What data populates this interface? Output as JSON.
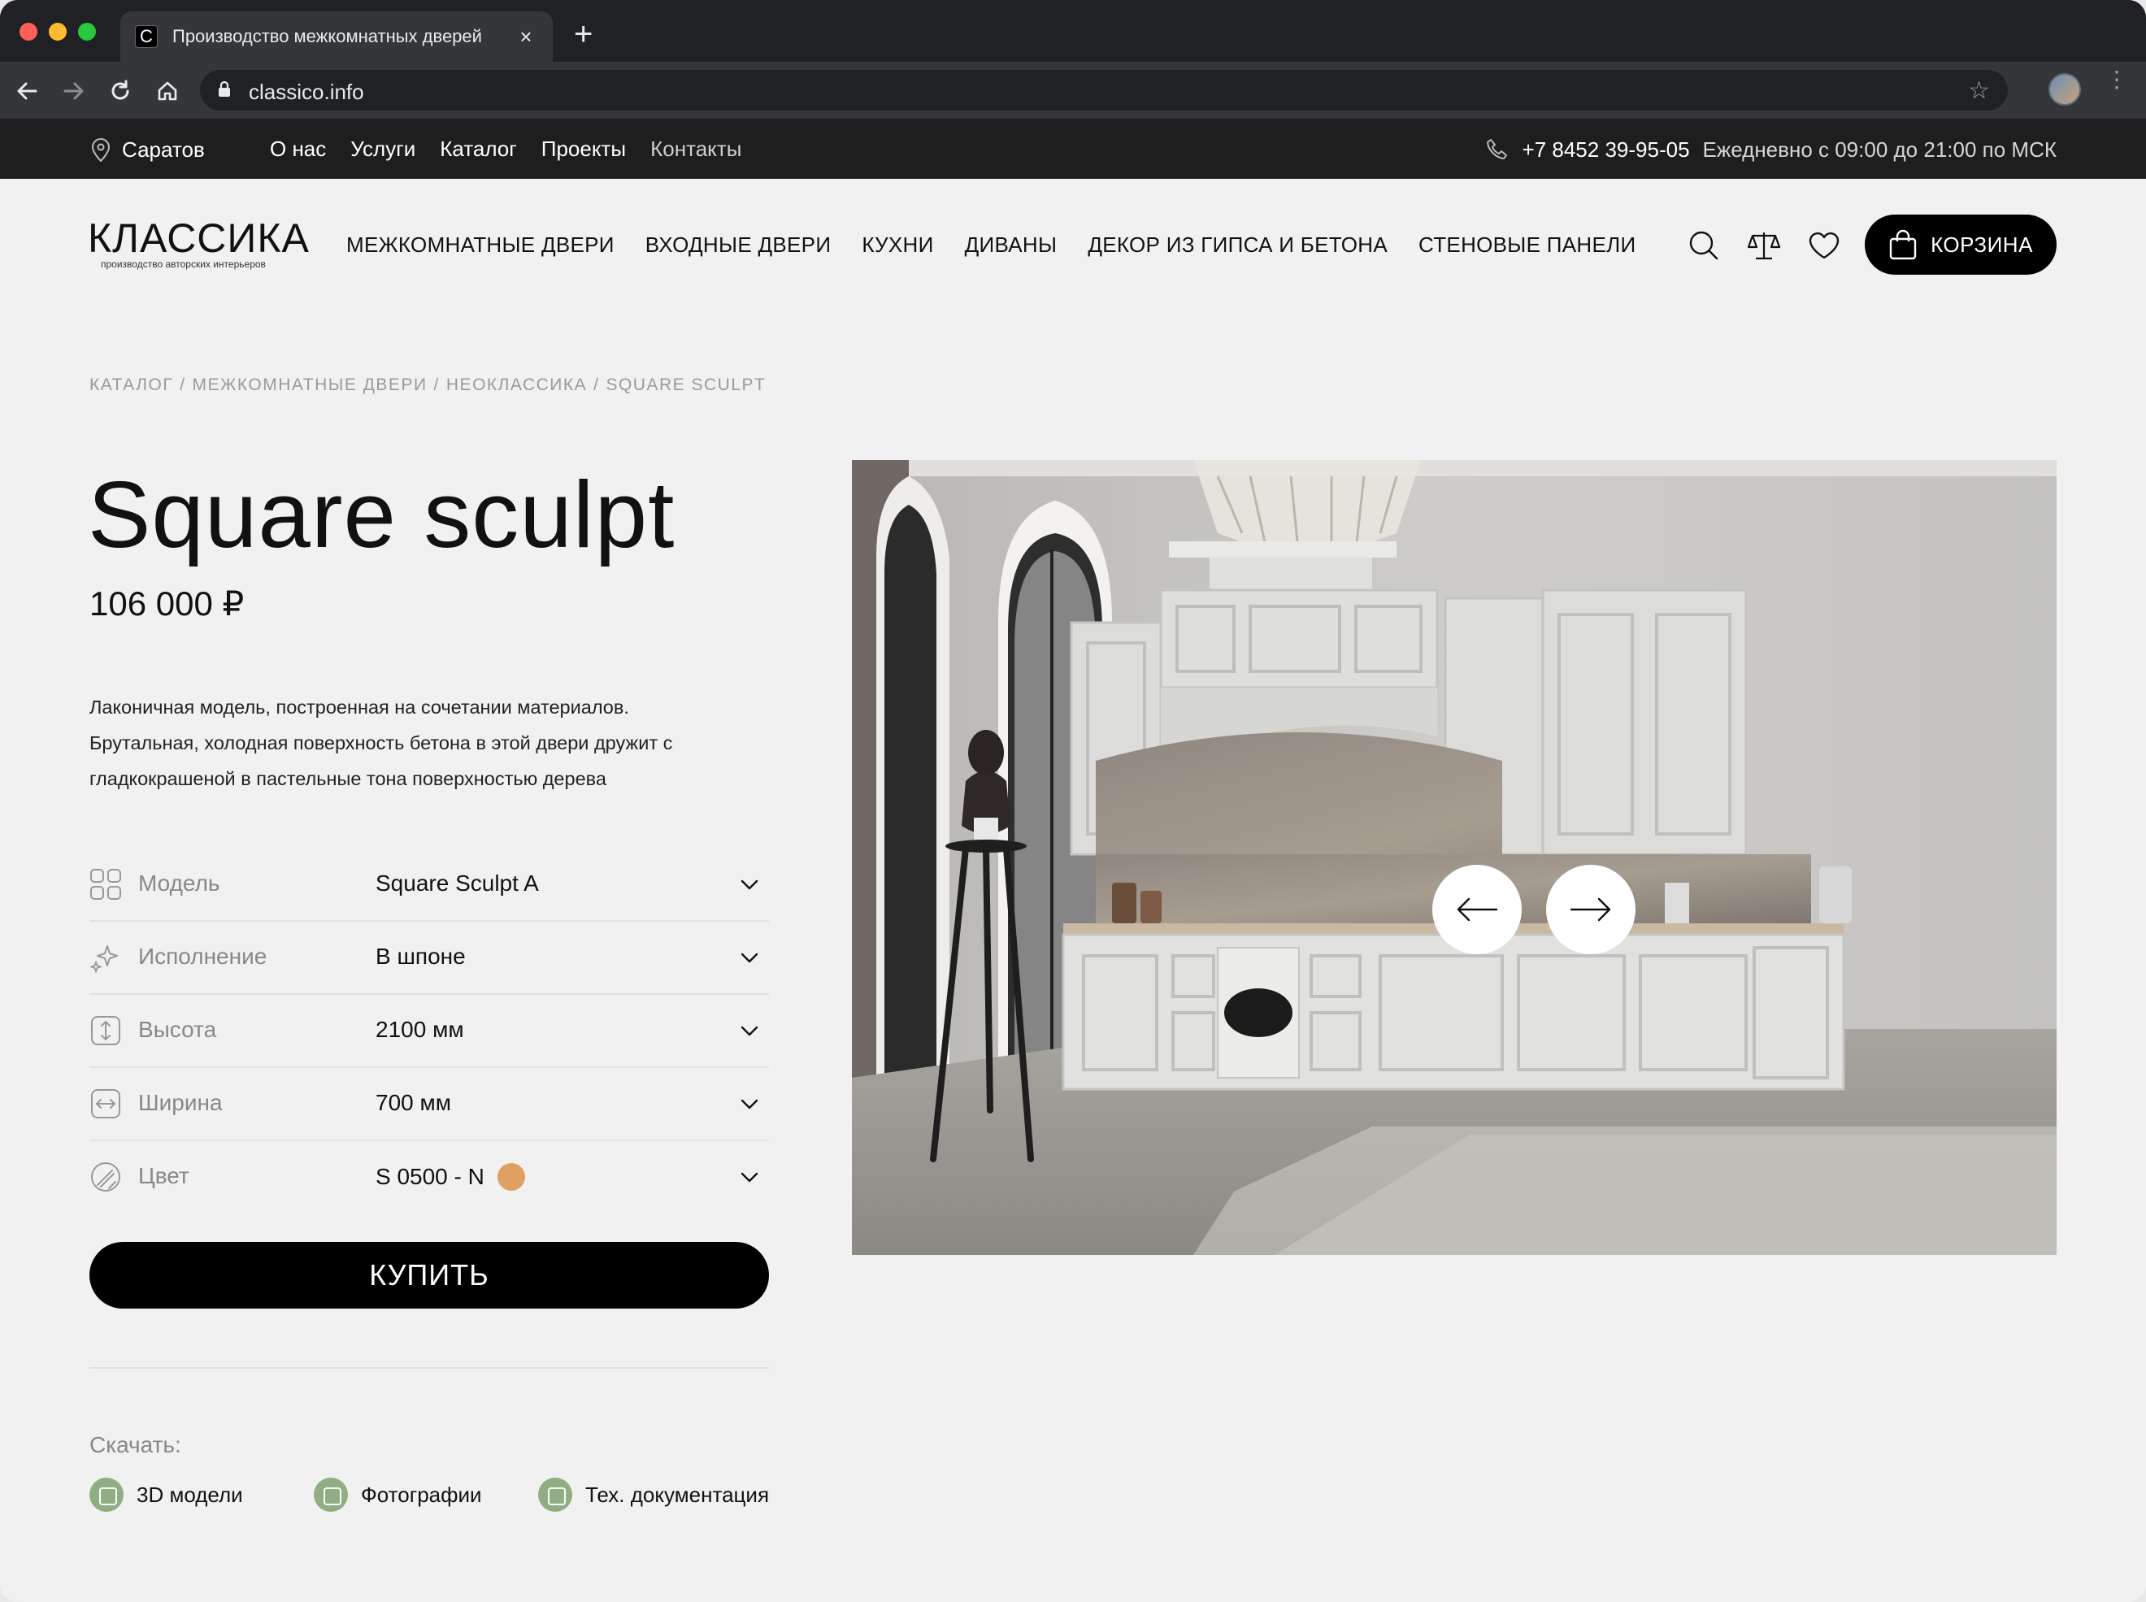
{
  "browser": {
    "tab_title": "Производство межкомнатных дверей",
    "tab_favicon": "C",
    "url": "classico.info"
  },
  "topbar": {
    "city": "Саратов",
    "links": [
      "О нас",
      "Услуги",
      "Каталог",
      "Проекты",
      "Контакты"
    ],
    "phone": "+7 8452 39-95-05",
    "hours": "Ежедневно с 09:00 до 21:00 по МСК"
  },
  "header": {
    "logo_main": "КЛАССИКА",
    "logo_sub": "производство авторских интерьеров",
    "nav": [
      "МЕЖКОМНАТНЫЕ ДВЕРИ",
      "ВХОДНЫЕ ДВЕРИ",
      "КУХНИ",
      "ДИВАНЫ",
      "ДЕКОР ИЗ ГИПСА И БЕТОНА",
      "СТЕНОВЫЕ ПАНЕЛИ"
    ],
    "cart_label": "КОРЗИНА"
  },
  "breadcrumb": [
    "КАТАЛОГ",
    "/",
    "МЕЖКОМНАТНЫЕ ДВЕРИ",
    "/",
    "НЕОКЛАССИКА",
    "/",
    "SQUARE SCULPT"
  ],
  "product": {
    "title": "Square sculpt",
    "price": "106 000 ₽",
    "description": "Лаконичная модель, построенная на сочетании материалов. Брутальная, холодная поверхность бетона в этой двери дружит с гладкокрашеной в пастельные тона поверхностью дерева",
    "options": [
      {
        "label": "Модель",
        "value": "Square Sculpt A",
        "icon": "grid-icon"
      },
      {
        "label": "Исполнение",
        "value": "В шпоне",
        "icon": "sparkle-icon"
      },
      {
        "label": "Высота",
        "value": "2100 мм",
        "icon": "height-icon"
      },
      {
        "label": "Ширина",
        "value": "700 мм",
        "icon": "width-icon"
      },
      {
        "label": "Цвет",
        "value": "S 0500 - N",
        "icon": "palette-icon",
        "swatch": "#e0a064"
      }
    ],
    "buy_label": "КУПИТЬ"
  },
  "downloads": {
    "title": "Скачать:",
    "items": [
      "3D модели",
      "Фотографии",
      "Тех. документация"
    ],
    "icon_color": "#8fae81"
  }
}
